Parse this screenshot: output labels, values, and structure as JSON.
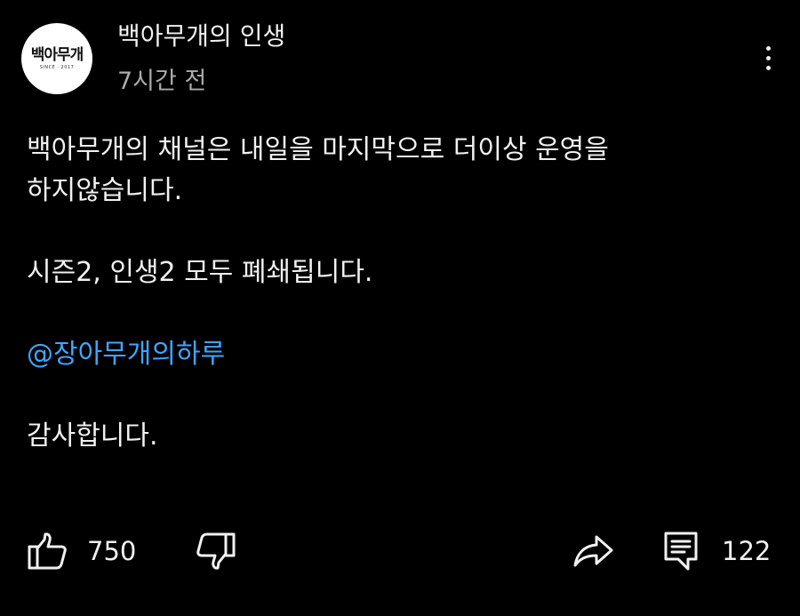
{
  "post": {
    "avatar_text": "백아무개",
    "avatar_subtext": "SINCE · 2017",
    "channel_name": "백아무개의 인생",
    "time": "7시간 전",
    "body": {
      "line1": "백아무개의 채널은 내일을 마지막으로 더이상 운영을",
      "line2": "하지않습니다.",
      "line3": "시즌2, 인생2 모두 폐쇄됩니다.",
      "mention": "@장아무개의하루",
      "line5": "감사합니다."
    }
  },
  "actions": {
    "like_count": "750",
    "comment_count": "122"
  },
  "icons": {
    "like": "thumbs-up-icon",
    "dislike": "thumbs-down-icon",
    "share": "share-icon",
    "comment": "comment-icon",
    "menu": "more-vertical-icon"
  },
  "colors": {
    "background": "#000000",
    "text": "#f1f1f1",
    "secondary_text": "#aaaaaa",
    "link": "#3ea6ff"
  }
}
